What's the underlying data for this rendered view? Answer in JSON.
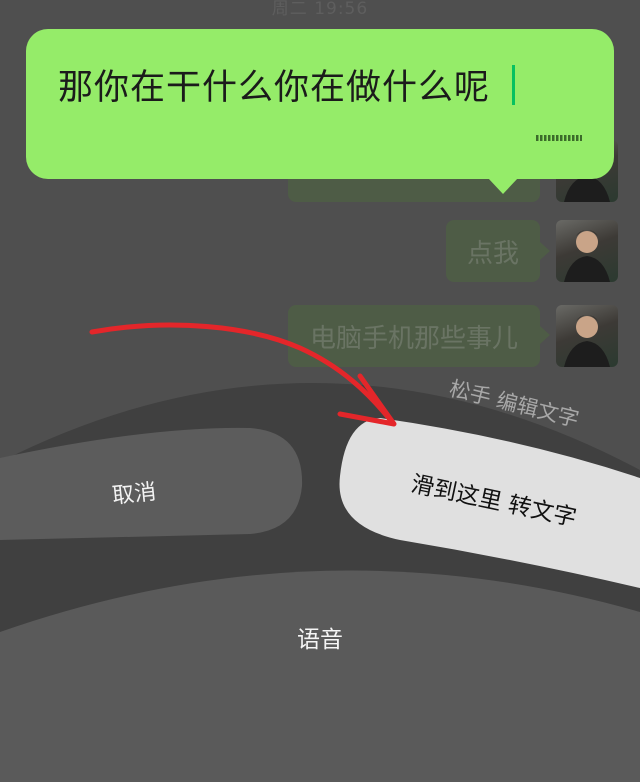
{
  "chat": {
    "timestamp": "周二 19:56",
    "messages": [
      {
        "text": "",
        "avatar": "user-avatar"
      },
      {
        "text": "点我",
        "avatar": "user-avatar"
      },
      {
        "text": "电脑手机那些事儿",
        "avatar": "user-avatar"
      }
    ]
  },
  "voice_input": {
    "recognized_text": "那你在干什么你在做什么呢",
    "indicator_icon": "voice-level-dots-icon"
  },
  "hints": {
    "release_edit": "松手 编辑文字"
  },
  "controls": {
    "cancel_label": "取消",
    "convert_label": "滑到这里 转文字",
    "voice_label": "语音"
  },
  "colors": {
    "bubble_green": "#95ec69",
    "cursor_green": "#07c160",
    "annotation_red": "#e4262a",
    "convert_button": "#e0e0e0",
    "cancel_button": "#5c5c5c"
  }
}
